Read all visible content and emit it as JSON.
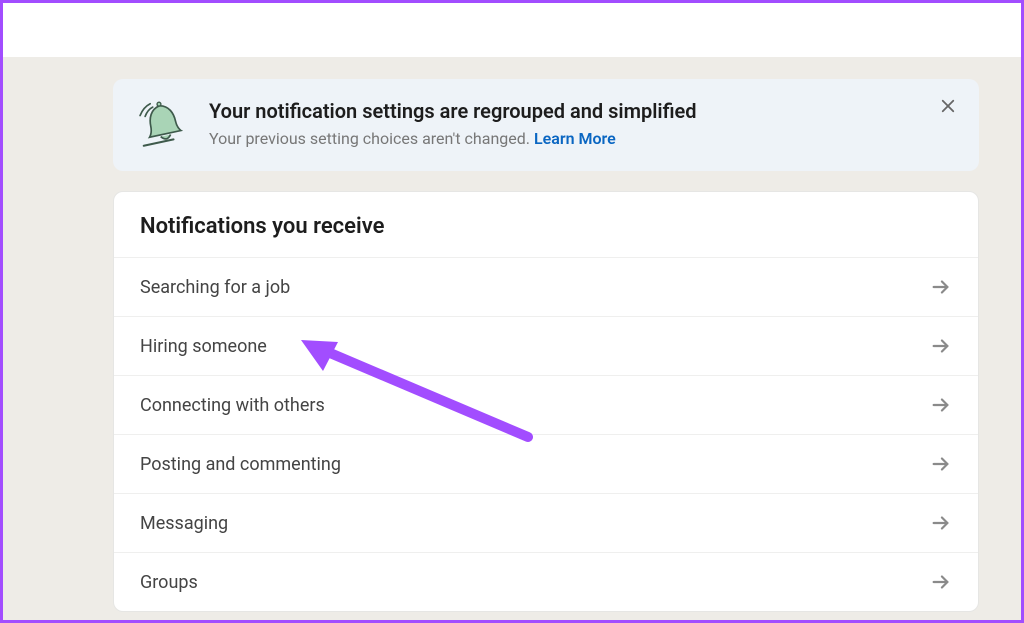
{
  "banner": {
    "title": "Your notification settings are regrouped and simplified",
    "subtext": "Your previous setting choices aren't changed. ",
    "link_text": "Learn More"
  },
  "section": {
    "title": "Notifications you receive",
    "items": [
      {
        "label": "Searching for a job"
      },
      {
        "label": "Hiring someone"
      },
      {
        "label": "Connecting with others"
      },
      {
        "label": "Posting and commenting"
      },
      {
        "label": "Messaging"
      },
      {
        "label": "Groups"
      }
    ]
  },
  "colors": {
    "annotation_arrow": "#a24dff",
    "link": "#0a66c2",
    "banner_bg": "#eef3f8",
    "bell_fill": "#a9d4b6",
    "bell_stroke": "#3e5a4b"
  }
}
